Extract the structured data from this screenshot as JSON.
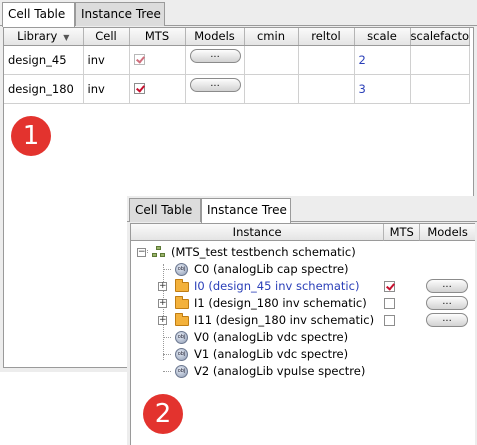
{
  "panel1": {
    "tabs": [
      {
        "label": "Cell Table",
        "active": true
      },
      {
        "label": "Instance Tree",
        "active": false
      }
    ],
    "columns": [
      "Library",
      "Cell",
      "MTS",
      "Models",
      "cmin",
      "reltol",
      "scale",
      "scalefacto"
    ],
    "rows": [
      {
        "library": "design_45",
        "cell": "inv",
        "mts": true,
        "mts_style": "dim",
        "models": "...",
        "scale": "2"
      },
      {
        "library": "design_180",
        "cell": "inv",
        "mts": true,
        "mts_style": "normal",
        "models": "...",
        "scale": "3"
      }
    ],
    "badge": "1"
  },
  "panel2": {
    "tabs": [
      {
        "label": "Cell Table",
        "active": false
      },
      {
        "label": "Instance Tree",
        "active": true
      }
    ],
    "columns": [
      "Instance",
      "MTS",
      "Models"
    ],
    "rows": [
      {
        "label": "(MTS_test testbench schematic)",
        "level": 0,
        "expander": "−",
        "icon": "hierarchy-icon"
      },
      {
        "label": "C0 (analogLib cap spectre)",
        "level": 1,
        "icon": "cell-icon"
      },
      {
        "label": "I0 (design_45 inv schematic)",
        "level": 1,
        "expander": "+",
        "icon": "folder-icon",
        "highlight": true,
        "mts": true,
        "models": "..."
      },
      {
        "label": "I1 (design_180 inv schematic)",
        "level": 1,
        "expander": "+",
        "icon": "folder-icon",
        "mts": false,
        "models": "..."
      },
      {
        "label": "I11 (design_180 inv schematic)",
        "level": 1,
        "expander": "+",
        "icon": "folder-icon",
        "mts": false,
        "models": "..."
      },
      {
        "label": "V0 (analogLib vdc spectre)",
        "level": 1,
        "icon": "cell-icon"
      },
      {
        "label": "V1 (analogLib vdc spectre)",
        "level": 1,
        "icon": "cell-icon"
      },
      {
        "label": "V2 (analogLib vpulse spectre)",
        "level": 1,
        "icon": "cell-icon"
      }
    ],
    "badge": "2"
  },
  "colors": {
    "badge": "#e3332e",
    "checkmark": "#c8102e",
    "link_blue": "#2a3fb8"
  }
}
